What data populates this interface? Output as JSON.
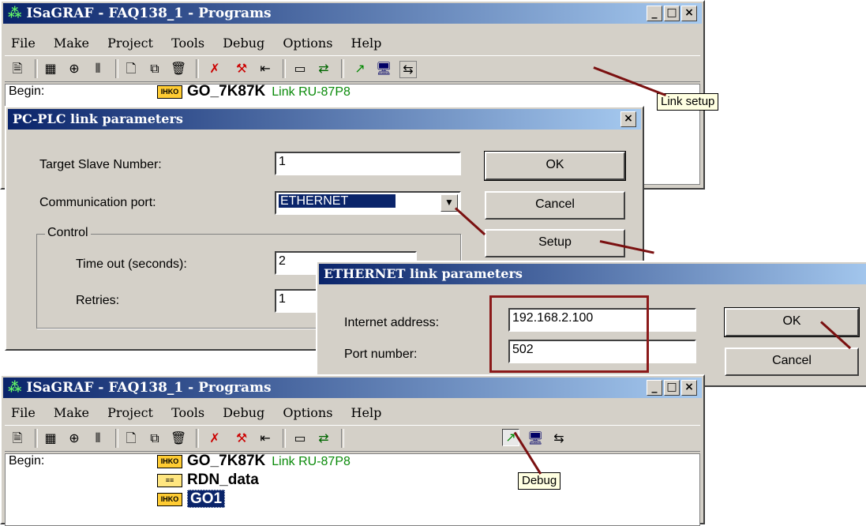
{
  "main_window": {
    "title": "ISaGRAF - FAQ138_1 - Programs",
    "menu": [
      "File",
      "Make",
      "Project",
      "Tools",
      "Debug",
      "Options",
      "Help"
    ],
    "programs_label": "Begin:",
    "program_name": "GO_7K87K",
    "program_link": "Link RU-87P8"
  },
  "link_dialog": {
    "title": "PC-PLC link parameters",
    "target_label": "Target Slave Number:",
    "target_value": "1",
    "port_label": "Communication port:",
    "port_value": "ETHERNET",
    "control_group": "Control",
    "timeout_label": "Time out (seconds):",
    "timeout_value": "2",
    "retries_label": "Retries:",
    "retries_value": "1",
    "ok": "OK",
    "cancel": "Cancel",
    "setup": "Setup"
  },
  "eth_dialog": {
    "title": "ETHERNET link parameters",
    "ip_label": "Internet address:",
    "ip_value": "192.168.2.100",
    "port_label": "Port number:",
    "port_value": "502",
    "ok": "OK",
    "cancel": "Cancel"
  },
  "bottom_window": {
    "title": "ISaGRAF - FAQ138_1 - Programs",
    "menu": [
      "File",
      "Make",
      "Project",
      "Tools",
      "Debug",
      "Options",
      "Help"
    ],
    "programs_label": "Begin:",
    "programs": [
      {
        "name": "GO_7K87K",
        "link": "Link RU-87P8",
        "badge": "IHKO"
      },
      {
        "name": "RDN_data",
        "link": "",
        "badge": "≡≡"
      },
      {
        "name": "GO1",
        "link": "",
        "badge": "IHKO"
      }
    ]
  },
  "callouts": {
    "link_setup": "Link setup",
    "debug": "Debug"
  },
  "colors": {
    "title_active": "#0a246a",
    "title_gradient_end": "#a6caf0",
    "annotation_arrow": "#7a1010",
    "highlight_box": "#8b1a1a",
    "link_text": "#0a8a0a"
  }
}
